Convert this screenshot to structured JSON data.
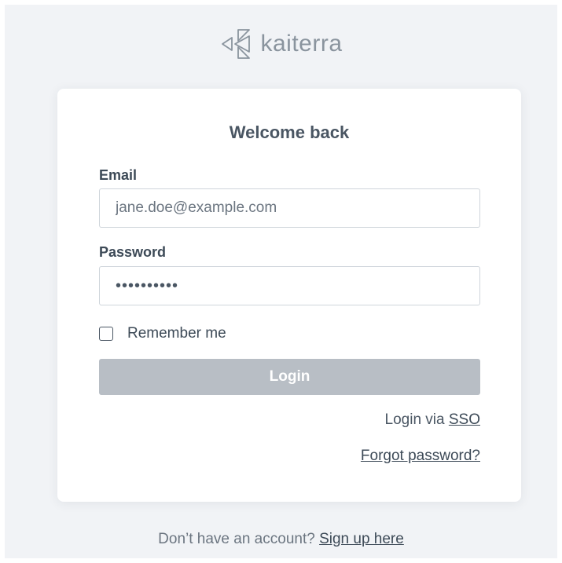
{
  "brand": {
    "name": "kaiterra",
    "logo_icon": "kaiterra-triangles-logo"
  },
  "login_card": {
    "title": "Welcome back",
    "email": {
      "label": "Email",
      "placeholder": "jane.doe@example.com",
      "value": ""
    },
    "password": {
      "label": "Password",
      "value": "••••••••••"
    },
    "remember_me": {
      "label": "Remember me",
      "checked": false
    },
    "login_button": "Login",
    "sso": {
      "prefix": "Login via ",
      "link": "SSO"
    },
    "forgot_password": "Forgot password?"
  },
  "footer": {
    "prefix": "Don’t have an account? ",
    "signup_link": "Sign up here"
  },
  "colors": {
    "background": "#f1f3f6",
    "card": "#ffffff",
    "disabled_button": "#b8bec5",
    "text": "#3d4a57",
    "brand_gray": "#8a949e"
  }
}
